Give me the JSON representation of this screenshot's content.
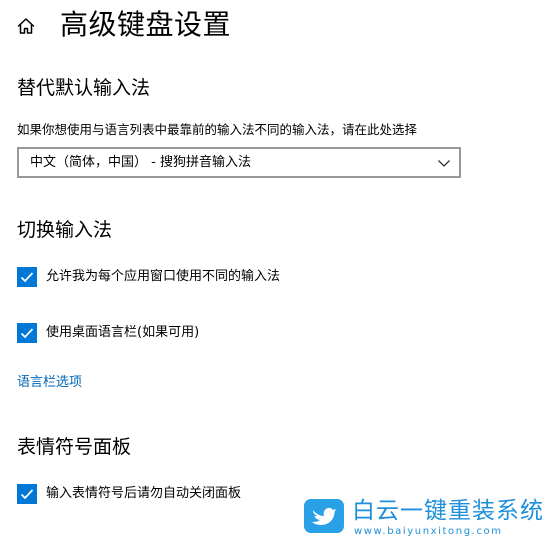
{
  "header": {
    "title": "高级键盘设置",
    "home_icon": "home-icon"
  },
  "override_section": {
    "heading": "替代默认输入法",
    "description": "如果你想使用与语言列表中最靠前的输入法不同的输入法，请在此处选择",
    "dropdown": {
      "selected": "中文（简体，中国） - 搜狗拼音输入法",
      "icon": "chevron-down-icon"
    }
  },
  "switch_section": {
    "heading": "切换输入法",
    "options": [
      {
        "label": "允许我为每个应用窗口使用不同的输入法",
        "checked": true
      },
      {
        "label": "使用桌面语言栏(如果可用)",
        "checked": true
      }
    ],
    "link": "语言栏选项"
  },
  "emoji_section": {
    "heading": "表情符号面板",
    "options": [
      {
        "label": "输入表情符号后请勿自动关闭面板",
        "checked": true
      }
    ]
  },
  "watermark": {
    "title": "白云一键重装系统",
    "url": "www.baiyunxitong.com",
    "icon": "bird-logo-icon",
    "color": "#1e8fdb"
  },
  "colors": {
    "accent": "#0078d7",
    "link": "#0067b8"
  }
}
